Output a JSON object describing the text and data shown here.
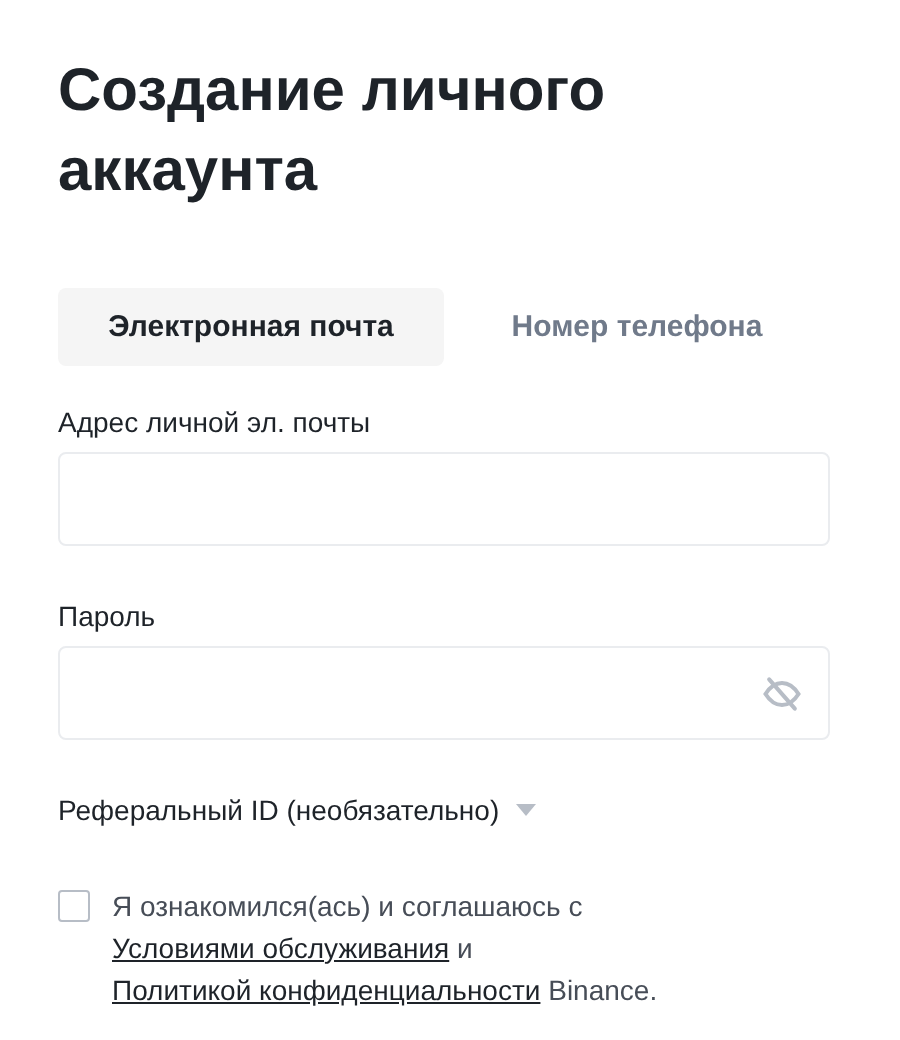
{
  "title": "Создание личного аккаунта",
  "tabs": [
    {
      "label": "Электронная почта",
      "selected": true
    },
    {
      "label": "Номер телефона",
      "selected": false
    }
  ],
  "fields": [
    {
      "label": "Адрес личной эл. почты",
      "kind": "text"
    },
    {
      "label": "Пароль",
      "kind": "password"
    }
  ],
  "referral": {
    "label": "Реферальный ID (необязательно)",
    "expanded": false
  },
  "agreement": {
    "checked": false,
    "parts": [
      {
        "kind": "text",
        "text": "Я ознакомился(ась) и соглашаюсь с "
      },
      {
        "kind": "link",
        "text": "Условиями обслуживания"
      },
      {
        "kind": "text",
        "text": " и "
      },
      {
        "kind": "link",
        "text": "Политикой конфиденциальности"
      },
      {
        "kind": "text",
        "text": " Binance."
      }
    ]
  }
}
